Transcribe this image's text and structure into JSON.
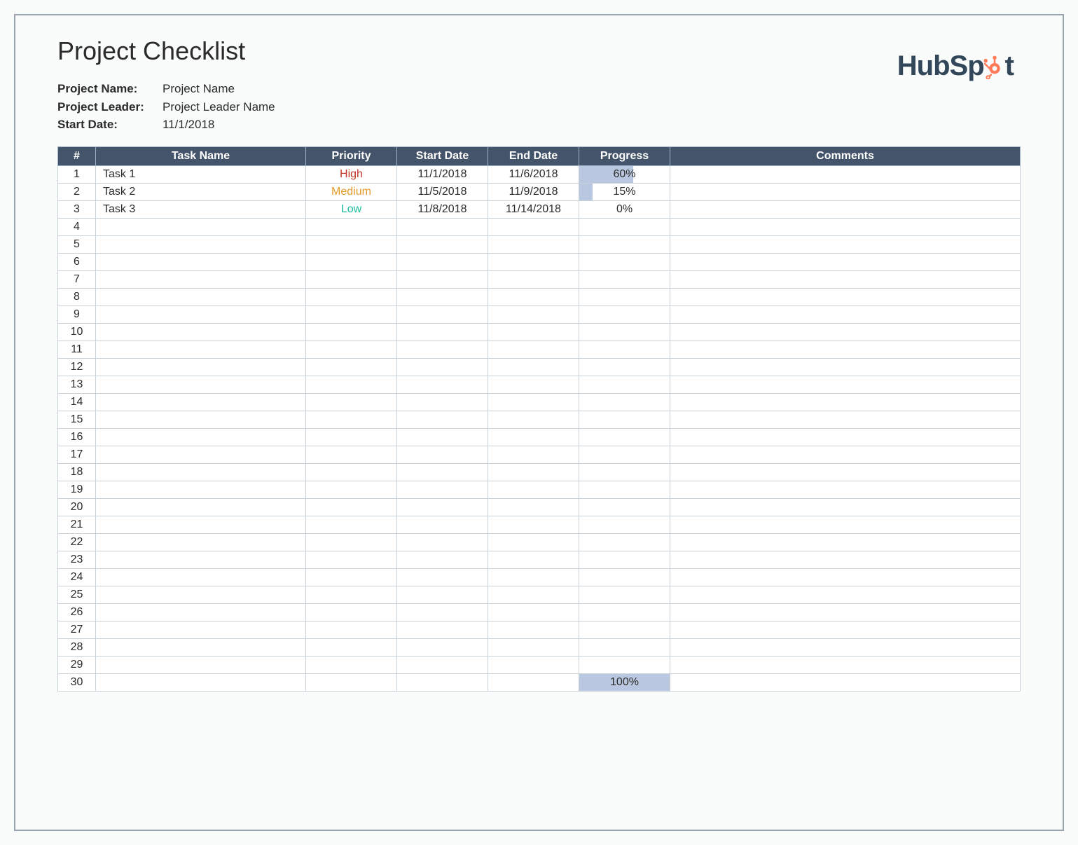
{
  "title": "Project Checklist",
  "meta": {
    "name_label": "Project Name:",
    "name_value": "Project Name",
    "leader_label": "Project Leader:",
    "leader_value": "Project Leader Name",
    "start_label": "Start Date:",
    "start_value": "11/1/2018"
  },
  "logo": {
    "text_a": "HubSp",
    "text_b": "t",
    "color_accent": "#ff7a59",
    "color_text": "#33475b"
  },
  "columns": {
    "num": "#",
    "task": "Task Name",
    "priority": "Priority",
    "start": "Start Date",
    "end": "End Date",
    "progress": "Progress",
    "comments": "Comments"
  },
  "rows": [
    {
      "num": 1,
      "task": "Task 1",
      "priority": "High",
      "priority_class": "high",
      "start": "11/1/2018",
      "end": "11/6/2018",
      "progress": 60,
      "progress_label": "60%",
      "comments": ""
    },
    {
      "num": 2,
      "task": "Task 2",
      "priority": "Medium",
      "priority_class": "medium",
      "start": "11/5/2018",
      "end": "11/9/2018",
      "progress": 15,
      "progress_label": "15%",
      "comments": ""
    },
    {
      "num": 3,
      "task": "Task 3",
      "priority": "Low",
      "priority_class": "low",
      "start": "11/8/2018",
      "end": "11/14/2018",
      "progress": 0,
      "progress_label": "0%",
      "comments": ""
    },
    {
      "num": 4,
      "task": "",
      "priority": "",
      "priority_class": "",
      "start": "",
      "end": "",
      "progress": null,
      "progress_label": "",
      "comments": ""
    },
    {
      "num": 5,
      "task": "",
      "priority": "",
      "priority_class": "",
      "start": "",
      "end": "",
      "progress": null,
      "progress_label": "",
      "comments": ""
    },
    {
      "num": 6,
      "task": "",
      "priority": "",
      "priority_class": "",
      "start": "",
      "end": "",
      "progress": null,
      "progress_label": "",
      "comments": ""
    },
    {
      "num": 7,
      "task": "",
      "priority": "",
      "priority_class": "",
      "start": "",
      "end": "",
      "progress": null,
      "progress_label": "",
      "comments": ""
    },
    {
      "num": 8,
      "task": "",
      "priority": "",
      "priority_class": "",
      "start": "",
      "end": "",
      "progress": null,
      "progress_label": "",
      "comments": ""
    },
    {
      "num": 9,
      "task": "",
      "priority": "",
      "priority_class": "",
      "start": "",
      "end": "",
      "progress": null,
      "progress_label": "",
      "comments": ""
    },
    {
      "num": 10,
      "task": "",
      "priority": "",
      "priority_class": "",
      "start": "",
      "end": "",
      "progress": null,
      "progress_label": "",
      "comments": ""
    },
    {
      "num": 11,
      "task": "",
      "priority": "",
      "priority_class": "",
      "start": "",
      "end": "",
      "progress": null,
      "progress_label": "",
      "comments": ""
    },
    {
      "num": 12,
      "task": "",
      "priority": "",
      "priority_class": "",
      "start": "",
      "end": "",
      "progress": null,
      "progress_label": "",
      "comments": ""
    },
    {
      "num": 13,
      "task": "",
      "priority": "",
      "priority_class": "",
      "start": "",
      "end": "",
      "progress": null,
      "progress_label": "",
      "comments": ""
    },
    {
      "num": 14,
      "task": "",
      "priority": "",
      "priority_class": "",
      "start": "",
      "end": "",
      "progress": null,
      "progress_label": "",
      "comments": ""
    },
    {
      "num": 15,
      "task": "",
      "priority": "",
      "priority_class": "",
      "start": "",
      "end": "",
      "progress": null,
      "progress_label": "",
      "comments": ""
    },
    {
      "num": 16,
      "task": "",
      "priority": "",
      "priority_class": "",
      "start": "",
      "end": "",
      "progress": null,
      "progress_label": "",
      "comments": ""
    },
    {
      "num": 17,
      "task": "",
      "priority": "",
      "priority_class": "",
      "start": "",
      "end": "",
      "progress": null,
      "progress_label": "",
      "comments": ""
    },
    {
      "num": 18,
      "task": "",
      "priority": "",
      "priority_class": "",
      "start": "",
      "end": "",
      "progress": null,
      "progress_label": "",
      "comments": ""
    },
    {
      "num": 19,
      "task": "",
      "priority": "",
      "priority_class": "",
      "start": "",
      "end": "",
      "progress": null,
      "progress_label": "",
      "comments": ""
    },
    {
      "num": 20,
      "task": "",
      "priority": "",
      "priority_class": "",
      "start": "",
      "end": "",
      "progress": null,
      "progress_label": "",
      "comments": ""
    },
    {
      "num": 21,
      "task": "",
      "priority": "",
      "priority_class": "",
      "start": "",
      "end": "",
      "progress": null,
      "progress_label": "",
      "comments": ""
    },
    {
      "num": 22,
      "task": "",
      "priority": "",
      "priority_class": "",
      "start": "",
      "end": "",
      "progress": null,
      "progress_label": "",
      "comments": ""
    },
    {
      "num": 23,
      "task": "",
      "priority": "",
      "priority_class": "",
      "start": "",
      "end": "",
      "progress": null,
      "progress_label": "",
      "comments": ""
    },
    {
      "num": 24,
      "task": "",
      "priority": "",
      "priority_class": "",
      "start": "",
      "end": "",
      "progress": null,
      "progress_label": "",
      "comments": ""
    },
    {
      "num": 25,
      "task": "",
      "priority": "",
      "priority_class": "",
      "start": "",
      "end": "",
      "progress": null,
      "progress_label": "",
      "comments": ""
    },
    {
      "num": 26,
      "task": "",
      "priority": "",
      "priority_class": "",
      "start": "",
      "end": "",
      "progress": null,
      "progress_label": "",
      "comments": ""
    },
    {
      "num": 27,
      "task": "",
      "priority": "",
      "priority_class": "",
      "start": "",
      "end": "",
      "progress": null,
      "progress_label": "",
      "comments": ""
    },
    {
      "num": 28,
      "task": "",
      "priority": "",
      "priority_class": "",
      "start": "",
      "end": "",
      "progress": null,
      "progress_label": "",
      "comments": ""
    },
    {
      "num": 29,
      "task": "",
      "priority": "",
      "priority_class": "",
      "start": "",
      "end": "",
      "progress": null,
      "progress_label": "",
      "comments": ""
    },
    {
      "num": 30,
      "task": "",
      "priority": "",
      "priority_class": "",
      "start": "",
      "end": "",
      "progress": 100,
      "progress_label": "100%",
      "comments": ""
    }
  ]
}
